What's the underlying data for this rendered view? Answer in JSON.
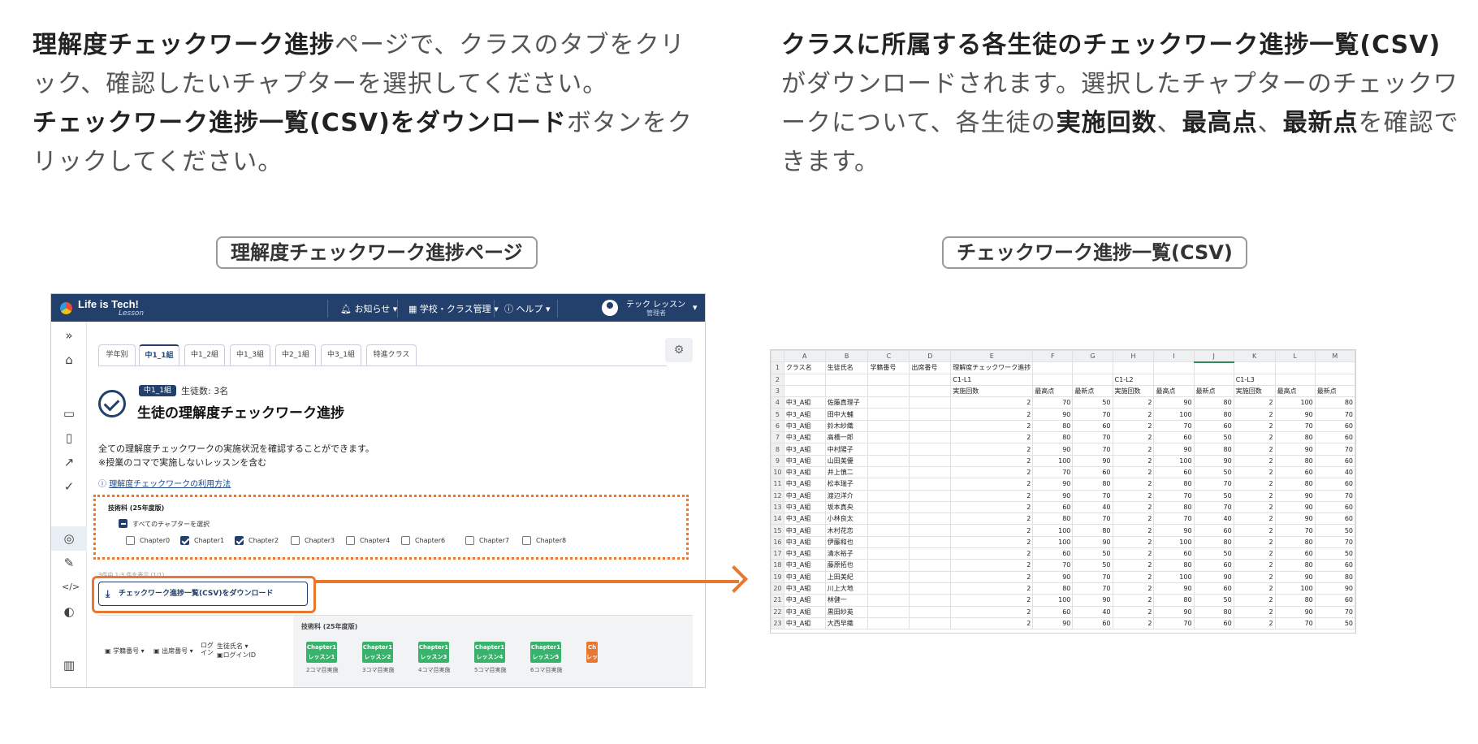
{
  "left_text": {
    "bold1": "理解度チェックワーク進捗",
    "text1": "ページで、クラスのタブをクリック、確認したいチャプターを選択してください。",
    "bold2": "チェックワーク進捗一覧(CSV)をダウンロード",
    "text2": "ボタンをクリックしてください。"
  },
  "right_text": {
    "bold1": "クラスに所属する各生徒のチェックワーク進捗一覧(CSV)",
    "text1": "がダウンロードされます。選択したチャプターのチェックワークについて、各生徒の",
    "bold2": "実施回数",
    "sep1": "、",
    "bold3": "最高点",
    "sep2": "、",
    "bold4": "最新点",
    "text2": "を確認できます。"
  },
  "captions": {
    "left": "理解度チェックワーク進捗ページ",
    "right": "チェックワーク進捗一覧(CSV)"
  },
  "app": {
    "logo": "Life is Tech!",
    "logo_sub": "Lesson",
    "topbar": {
      "notifications": "お知らせ",
      "school_menu": "学校・クラス管理",
      "help": "ヘルプ",
      "user_name": "テック レッスン",
      "user_role": "管理者"
    },
    "tabs": [
      "学年別",
      "中1_1組",
      "中1_2組",
      "中1_3組",
      "中2_1組",
      "中3_1組",
      "特進クラス"
    ],
    "active_tab": "中1_1組",
    "class_badge": "中1_1組",
    "student_count": "生徒数: 3名",
    "title": "生徒の理解度チェックワーク進捗",
    "desc1": "全ての理解度チェックワークの実施状況を確認することができます。",
    "desc2": "※授業のコマで実施しないレッスンを含む",
    "help_link": "理解度チェックワークの利用方法",
    "filter": {
      "subject": "技術科 (25年度版)",
      "select_all": "すべてのチャプターを選択",
      "chapters": [
        {
          "label": "Chapter0",
          "checked": false
        },
        {
          "label": "Chapter1",
          "checked": true
        },
        {
          "label": "Chapter2",
          "checked": true
        },
        {
          "label": "Chapter3",
          "checked": false
        },
        {
          "label": "Chapter4",
          "checked": false
        },
        {
          "label": "Chapter6",
          "checked": false
        },
        {
          "label": "Chapter7",
          "checked": false
        },
        {
          "label": "Chapter8",
          "checked": false
        }
      ]
    },
    "pager": "3件中 1-3 件を表示 (1/1)",
    "download_button": "チェックワーク進捗一覧(CSV)をダウンロード",
    "grid": {
      "col_student_no": "学籍番号",
      "col_attendance_no": "出席番号",
      "col_login": "ログ イン",
      "col_name": "生徒氏名",
      "col_login_id": "ログインID",
      "subject": "技術科 (25年度版)",
      "lessons": [
        {
          "chip": "Chapter1 レッスン1",
          "sub": "2コマ目実施"
        },
        {
          "chip": "Chapter1 レッスン2",
          "sub": "3コマ目実施"
        },
        {
          "chip": "Chapter1 レッスン3",
          "sub": "4コマ目実施"
        },
        {
          "chip": "Chapter1 レッスン4",
          "sub": "5コマ目実施"
        },
        {
          "chip": "Chapter1 レッスン5",
          "sub": "6コマ目実施"
        },
        {
          "chip": "Ch レッ",
          "sub": ""
        }
      ]
    }
  },
  "sheet": {
    "columns": [
      "A",
      "B",
      "C",
      "D",
      "E",
      "F",
      "G",
      "H",
      "I",
      "J",
      "K",
      "L",
      "M"
    ],
    "header_rows": [
      [
        "クラス名",
        "生徒氏名",
        "学籍番号",
        "出席番号",
        "理解度チェックワーク進捗",
        "",
        "",
        "",
        "",
        "",
        "",
        "",
        ""
      ],
      [
        "",
        "",
        "",
        "",
        "C1-L1",
        "",
        "",
        "C1-L2",
        "",
        "",
        "C1-L3",
        "",
        ""
      ],
      [
        "",
        "",
        "",
        "",
        "実施回数",
        "最高点",
        "最新点",
        "実施回数",
        "最高点",
        "最新点",
        "実施回数",
        "最高点",
        "最新点"
      ]
    ],
    "rows": [
      [
        "中3_A組",
        "佐藤真理子",
        "",
        "",
        "2",
        "70",
        "50",
        "2",
        "90",
        "80",
        "2",
        "100",
        "80"
      ],
      [
        "中3_A組",
        "田中大輔",
        "",
        "",
        "2",
        "90",
        "70",
        "2",
        "100",
        "80",
        "2",
        "90",
        "70"
      ],
      [
        "中3_A組",
        "鈴木紗織",
        "",
        "",
        "2",
        "80",
        "60",
        "2",
        "70",
        "60",
        "2",
        "70",
        "60"
      ],
      [
        "中3_A組",
        "高橋一郎",
        "",
        "",
        "2",
        "80",
        "70",
        "2",
        "60",
        "50",
        "2",
        "80",
        "60"
      ],
      [
        "中3_A組",
        "中村陽子",
        "",
        "",
        "2",
        "90",
        "70",
        "2",
        "90",
        "80",
        "2",
        "90",
        "70"
      ],
      [
        "中3_A組",
        "山田美優",
        "",
        "",
        "2",
        "100",
        "90",
        "2",
        "100",
        "90",
        "2",
        "80",
        "60"
      ],
      [
        "中3_A組",
        "井上慎二",
        "",
        "",
        "2",
        "70",
        "60",
        "2",
        "60",
        "50",
        "2",
        "60",
        "40"
      ],
      [
        "中3_A組",
        "松本瑞子",
        "",
        "",
        "2",
        "90",
        "80",
        "2",
        "80",
        "70",
        "2",
        "80",
        "60"
      ],
      [
        "中3_A組",
        "渡辺洋介",
        "",
        "",
        "2",
        "90",
        "70",
        "2",
        "70",
        "50",
        "2",
        "90",
        "70"
      ],
      [
        "中3_A組",
        "坂本真央",
        "",
        "",
        "2",
        "60",
        "40",
        "2",
        "80",
        "70",
        "2",
        "90",
        "60"
      ],
      [
        "中3_A組",
        "小林良太",
        "",
        "",
        "2",
        "80",
        "70",
        "2",
        "70",
        "40",
        "2",
        "90",
        "60"
      ],
      [
        "中3_A組",
        "木村花恋",
        "",
        "",
        "2",
        "100",
        "80",
        "2",
        "90",
        "60",
        "2",
        "70",
        "50"
      ],
      [
        "中3_A組",
        "伊藤和也",
        "",
        "",
        "2",
        "100",
        "90",
        "2",
        "100",
        "80",
        "2",
        "80",
        "70"
      ],
      [
        "中3_A組",
        "清水裕子",
        "",
        "",
        "2",
        "60",
        "50",
        "2",
        "60",
        "50",
        "2",
        "60",
        "50"
      ],
      [
        "中3_A組",
        "藤原拓也",
        "",
        "",
        "2",
        "70",
        "50",
        "2",
        "80",
        "60",
        "2",
        "80",
        "60"
      ],
      [
        "中3_A組",
        "上田美紀",
        "",
        "",
        "2",
        "90",
        "70",
        "2",
        "100",
        "90",
        "2",
        "90",
        "80"
      ],
      [
        "中3_A組",
        "川上大地",
        "",
        "",
        "2",
        "80",
        "70",
        "2",
        "90",
        "60",
        "2",
        "100",
        "90"
      ],
      [
        "中3_A組",
        "林健一",
        "",
        "",
        "2",
        "100",
        "90",
        "2",
        "80",
        "50",
        "2",
        "80",
        "60"
      ],
      [
        "中3_A組",
        "黒田紗英",
        "",
        "",
        "2",
        "60",
        "40",
        "2",
        "90",
        "80",
        "2",
        "90",
        "70"
      ],
      [
        "中3_A組",
        "大西早織",
        "",
        "",
        "2",
        "90",
        "60",
        "2",
        "70",
        "60",
        "2",
        "70",
        "50"
      ]
    ]
  },
  "colors": {
    "accent": "#e8782f",
    "navy": "#22406b",
    "lesson_green": "#37b36b"
  }
}
